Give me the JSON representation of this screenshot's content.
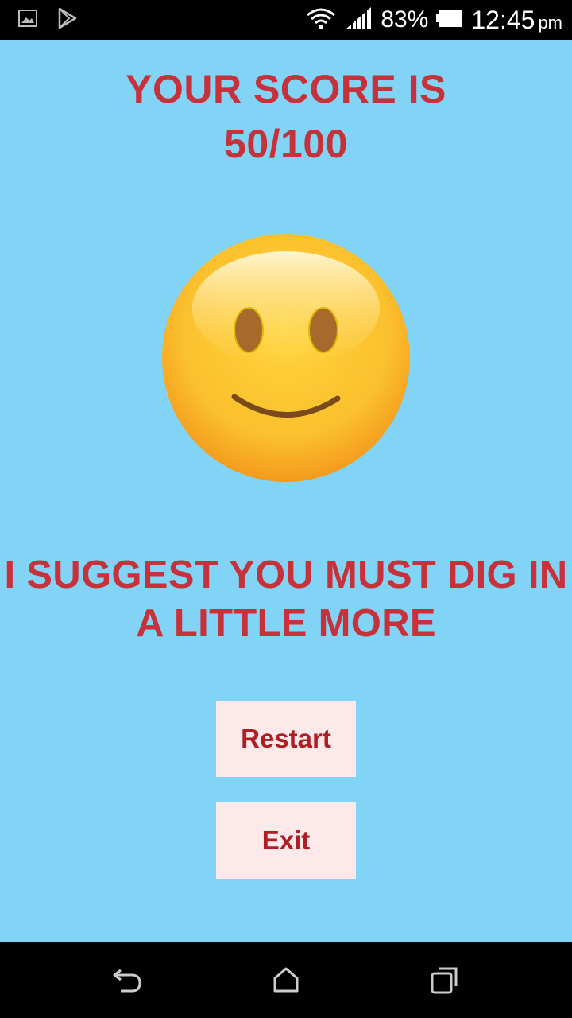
{
  "status_bar": {
    "icons_left": [
      "image-icon",
      "play-store-icon"
    ],
    "icons_right": [
      "wifi-icon",
      "signal-icon",
      "battery-icon"
    ],
    "battery_percent": "83%",
    "time": "12:45",
    "ampm": "pm"
  },
  "result": {
    "score_heading": "YOUR SCORE IS",
    "score_value": "50/100",
    "emoji": "slightly-smiling-face-icon",
    "message_line1": "I SUGGEST YOU MUST DIG IN",
    "message_line2": "A LITTLE MORE"
  },
  "buttons": {
    "restart_label": "Restart",
    "exit_label": "Exit"
  },
  "nav_bar": {
    "icons": [
      "back-icon",
      "home-icon",
      "recents-icon"
    ]
  },
  "colors": {
    "background": "#81d4f6",
    "text_red": "#c6313a",
    "button_bg": "#fde8ea",
    "button_text": "#b01e24"
  }
}
